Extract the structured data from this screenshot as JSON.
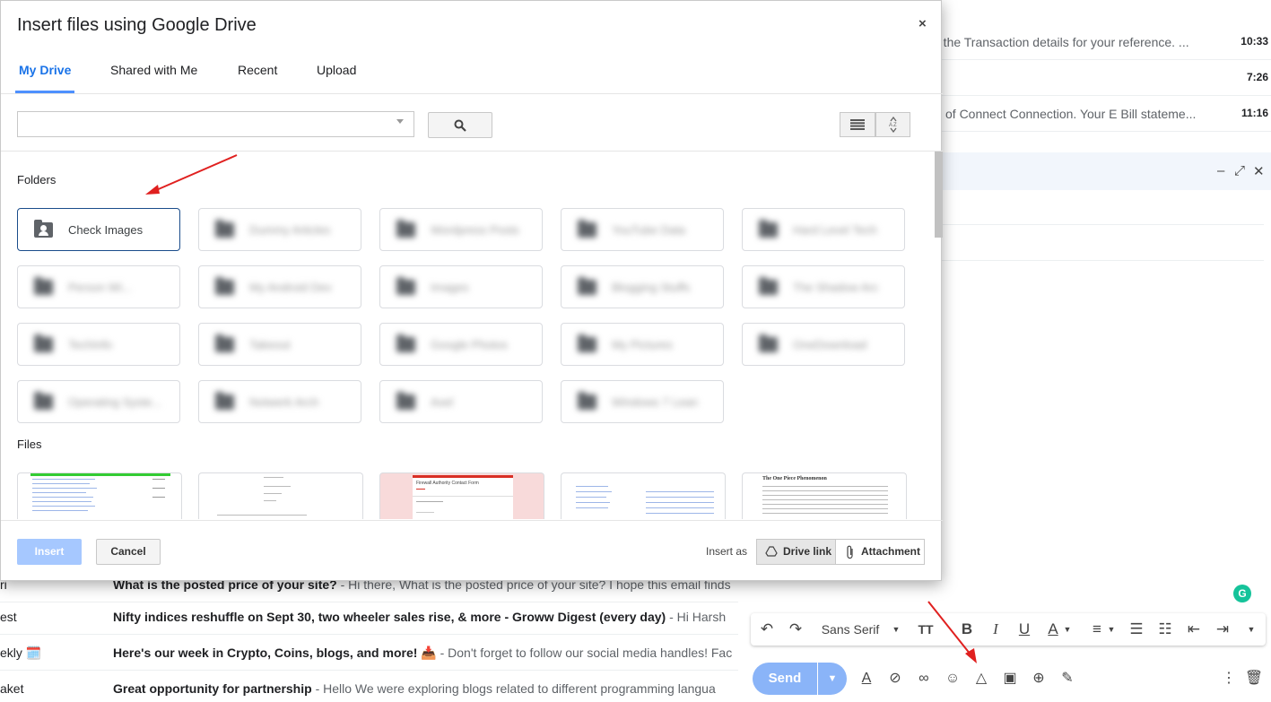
{
  "background": {
    "top_rows": [
      {
        "snippet": "e the Transaction details for your reference. ...",
        "time": "10:33"
      },
      {
        "snippet": "",
        "time": "7:26"
      },
      {
        "snippet": "of Connect Connection. Your E Bill stateme...",
        "time": "11:16"
      }
    ],
    "list_rows": [
      {
        "sender": "ri",
        "subject": "What is the posted price of your site?",
        "preview": " - Hi there, What is the posted price of your site? I hope this email finds"
      },
      {
        "sender": "est",
        "subject": "Nifty indices reshuffle on Sept 30, two wheeler sales rise, & more - Groww Digest (every day)",
        "preview": " - Hi Harsh"
      },
      {
        "sender": "ekly 🗓️",
        "subject": "Here's our week in Crypto, Coins, blogs, and more! 📥",
        "preview": " - Don't forget to follow our social media handles! Fac"
      },
      {
        "sender": "aket",
        "subject": "Great opportunity for partnership",
        "preview": " - Hello We were exploring blogs related to different programming langua"
      }
    ],
    "compose": {
      "controls": [
        "–",
        "⤢",
        "✕"
      ],
      "font_name": "Sans Serif",
      "send_label": "Send",
      "grammarly_letter": "G"
    }
  },
  "dialog": {
    "title": "Insert files using Google Drive",
    "close_glyph": "×",
    "tabs": [
      "My Drive",
      "Shared with Me",
      "Recent",
      "Upload"
    ],
    "search": {
      "value": "",
      "placeholder": ""
    },
    "folders_label": "Folders",
    "files_label": "Files",
    "folders": [
      "Check Images",
      "Dummy Articles",
      "Wordpress Posts",
      "YouTube Data",
      "Hard Level Tech",
      "Person Wi...",
      "My Android Dev",
      "Images",
      "Blogging Stuffs",
      "The Shadow Arc",
      "TechInfo",
      "Takeout",
      "Google Photos",
      "My Pictures",
      "OneDownload",
      "Operating Syste...",
      "Notwerk Arch",
      "Axel",
      "Windows 7 Lean"
    ],
    "files": [
      "spreadsheet",
      "document",
      "Firewall Authority Contact Form",
      "spreadsheet",
      "The One Piece Phenomenon"
    ],
    "insert_label": "Insert",
    "cancel_label": "Cancel",
    "insert_as_label": "Insert as",
    "drive_link_label": "Drive link",
    "attachment_label": "Attachment",
    "selected_folder": "Check Images",
    "accent_color": "#1a73e8"
  }
}
